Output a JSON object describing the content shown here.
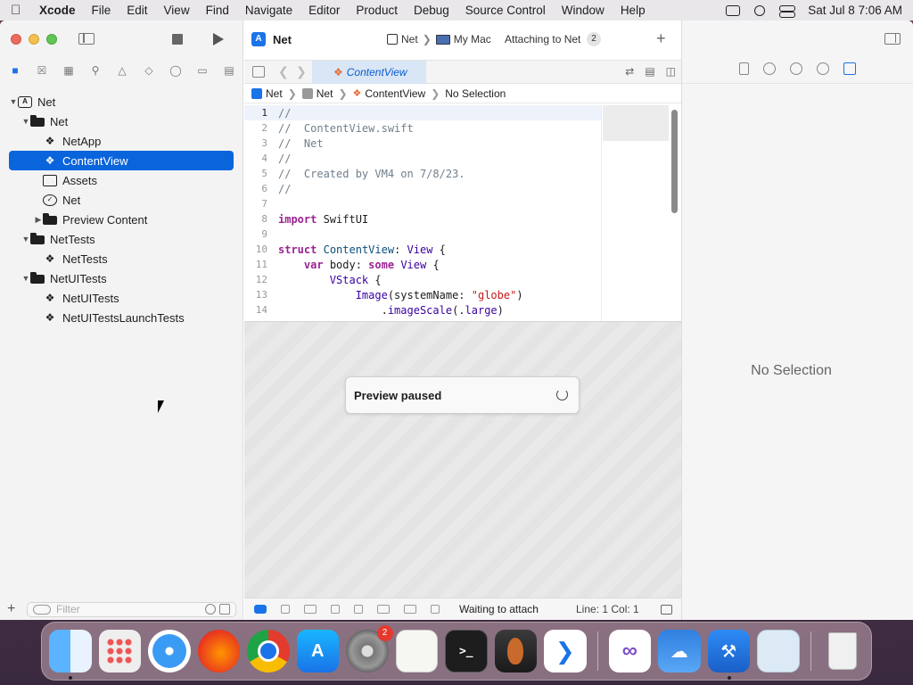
{
  "menubar": {
    "app": "Xcode",
    "items": [
      "File",
      "Edit",
      "View",
      "Find",
      "Navigate",
      "Editor",
      "Product",
      "Debug",
      "Source Control",
      "Window",
      "Help"
    ],
    "clock": "Sat Jul 8  7:06 AM"
  },
  "toolbar": {
    "project": "Net",
    "scheme": "Net",
    "destination": "My Mac",
    "status": "Attaching to Net",
    "status_count": "2"
  },
  "navigator": {
    "items": [
      {
        "label": "Net"
      },
      {
        "label": "Net"
      },
      {
        "label": "NetApp"
      },
      {
        "label": "ContentView"
      },
      {
        "label": "Assets"
      },
      {
        "label": "Net"
      },
      {
        "label": "Preview Content"
      },
      {
        "label": "NetTests"
      },
      {
        "label": "NetTests"
      },
      {
        "label": "NetUITests"
      },
      {
        "label": "NetUITests"
      },
      {
        "label": "NetUITestsLaunchTests"
      }
    ],
    "filter_placeholder": "Filter"
  },
  "editor": {
    "tab": "ContentView",
    "jump": [
      "Net",
      "Net",
      "ContentView",
      "No Selection"
    ],
    "preview_status": "Preview paused"
  },
  "code": {
    "line_numbers": [
      "1",
      "2",
      "3",
      "4",
      "5",
      "6",
      "7",
      "8",
      "9",
      "10",
      "11",
      "12",
      "13",
      "14"
    ]
  },
  "debugbar": {
    "status": "Waiting to attach",
    "position": "Line: 1  Col: 1"
  },
  "inspector": {
    "empty": "No Selection"
  },
  "dock": {
    "settings_badge": "2",
    "terminal_glyph": ">_"
  },
  "colors": {
    "accent": "#0a64dc",
    "keyword": "#9b2393",
    "string": "#c41a16",
    "comment": "#707f8c"
  }
}
